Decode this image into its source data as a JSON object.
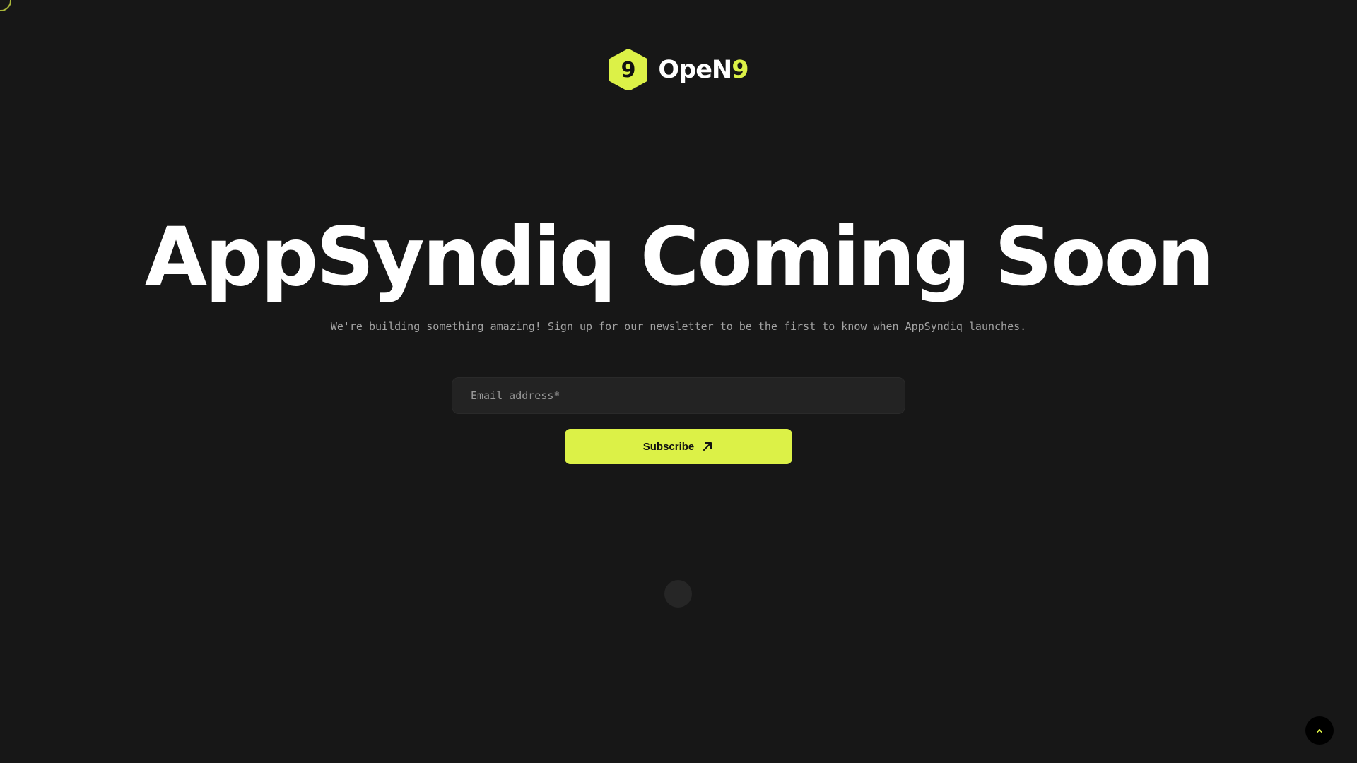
{
  "brand": {
    "name_main": "OpeN",
    "name_accent": "9",
    "logo_glyph": "9",
    "accent_color": "#dcf147"
  },
  "hero": {
    "title": "AppSyndiq Coming Soon",
    "subtitle": "We're building something amazing! Sign up for our newsletter to be the first to know when AppSyndiq launches."
  },
  "form": {
    "email_placeholder": "Email address*",
    "email_value": "",
    "subscribe_label": "Subscribe",
    "subscribe_icon": "arrow-up-right-icon"
  },
  "widgets": {
    "scroll_top_icon": "chevron-up-icon",
    "cursor_icon": "cursor-ring-icon"
  },
  "colors": {
    "background": "#171717",
    "accent": "#dcf147",
    "input_background": "#232323",
    "muted_text": "#a3a3a3"
  }
}
